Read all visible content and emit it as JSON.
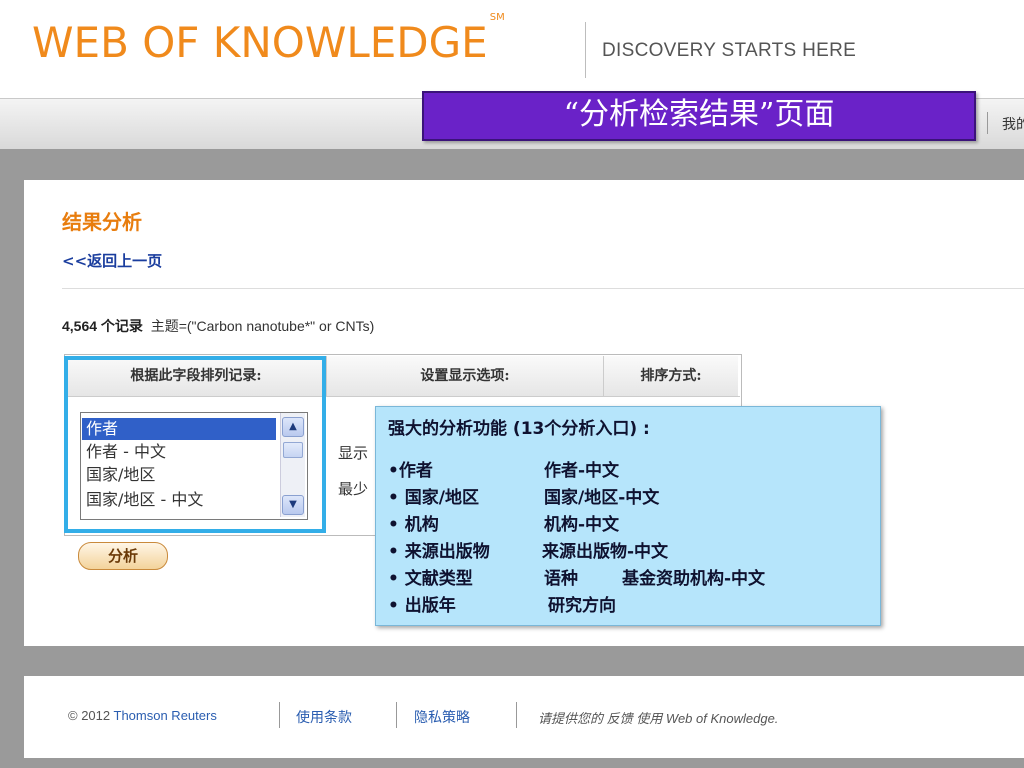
{
  "header": {
    "logo": "WEB OF KNOWLEDGE",
    "logo_mark": "SM",
    "tagline": "DISCOVERY STARTS HERE"
  },
  "banner": {
    "text": "“分析检索结果”页面"
  },
  "nav": {
    "partial_link": "我的"
  },
  "results": {
    "title": "结果分析",
    "back_link": "<<返回上一页",
    "record_count": "4,564 个记录",
    "query": "主题=(\"Carbon nanotube*\" or CNTs)"
  },
  "table": {
    "headers": [
      "根据此字段排列记录:",
      "设置显示选项:",
      "排序方式:"
    ],
    "field_options": [
      "作者",
      "作者 - 中文",
      "国家/地区",
      "国家/地区 - 中文"
    ],
    "selected_option": "作者",
    "display_partial_1": "显示",
    "display_partial_2": "最少",
    "analyze_button": "分析"
  },
  "callout": {
    "title": "强大的分析功能 (13个分析入口) :",
    "rows": [
      [
        "•作者",
        "作者-中文"
      ],
      [
        "• 国家/地区",
        "国家/地区-中文"
      ],
      [
        "• 机构",
        "机构-中文"
      ],
      [
        "• 来源出版物",
        "来源出版物-中文"
      ],
      [
        "• 文献类型",
        "语种",
        "基金资助机构-中文"
      ],
      [
        "• 出版年",
        "研究方向"
      ]
    ]
  },
  "footer": {
    "copyright_prefix": "© 2012 ",
    "company": "Thomson Reuters",
    "terms": "使用条款",
    "privacy": "隐私策略",
    "feedback_prefix": "请提供您的",
    "feedback_link": "反馈",
    "feedback_mid": "使用",
    "product": "Web of Knowledge."
  },
  "colors": {
    "brand_orange": "#f08a1c",
    "banner_purple": "#6a22c8",
    "highlight_blue": "#33aee8",
    "callout_bg": "#b6e5fb"
  }
}
